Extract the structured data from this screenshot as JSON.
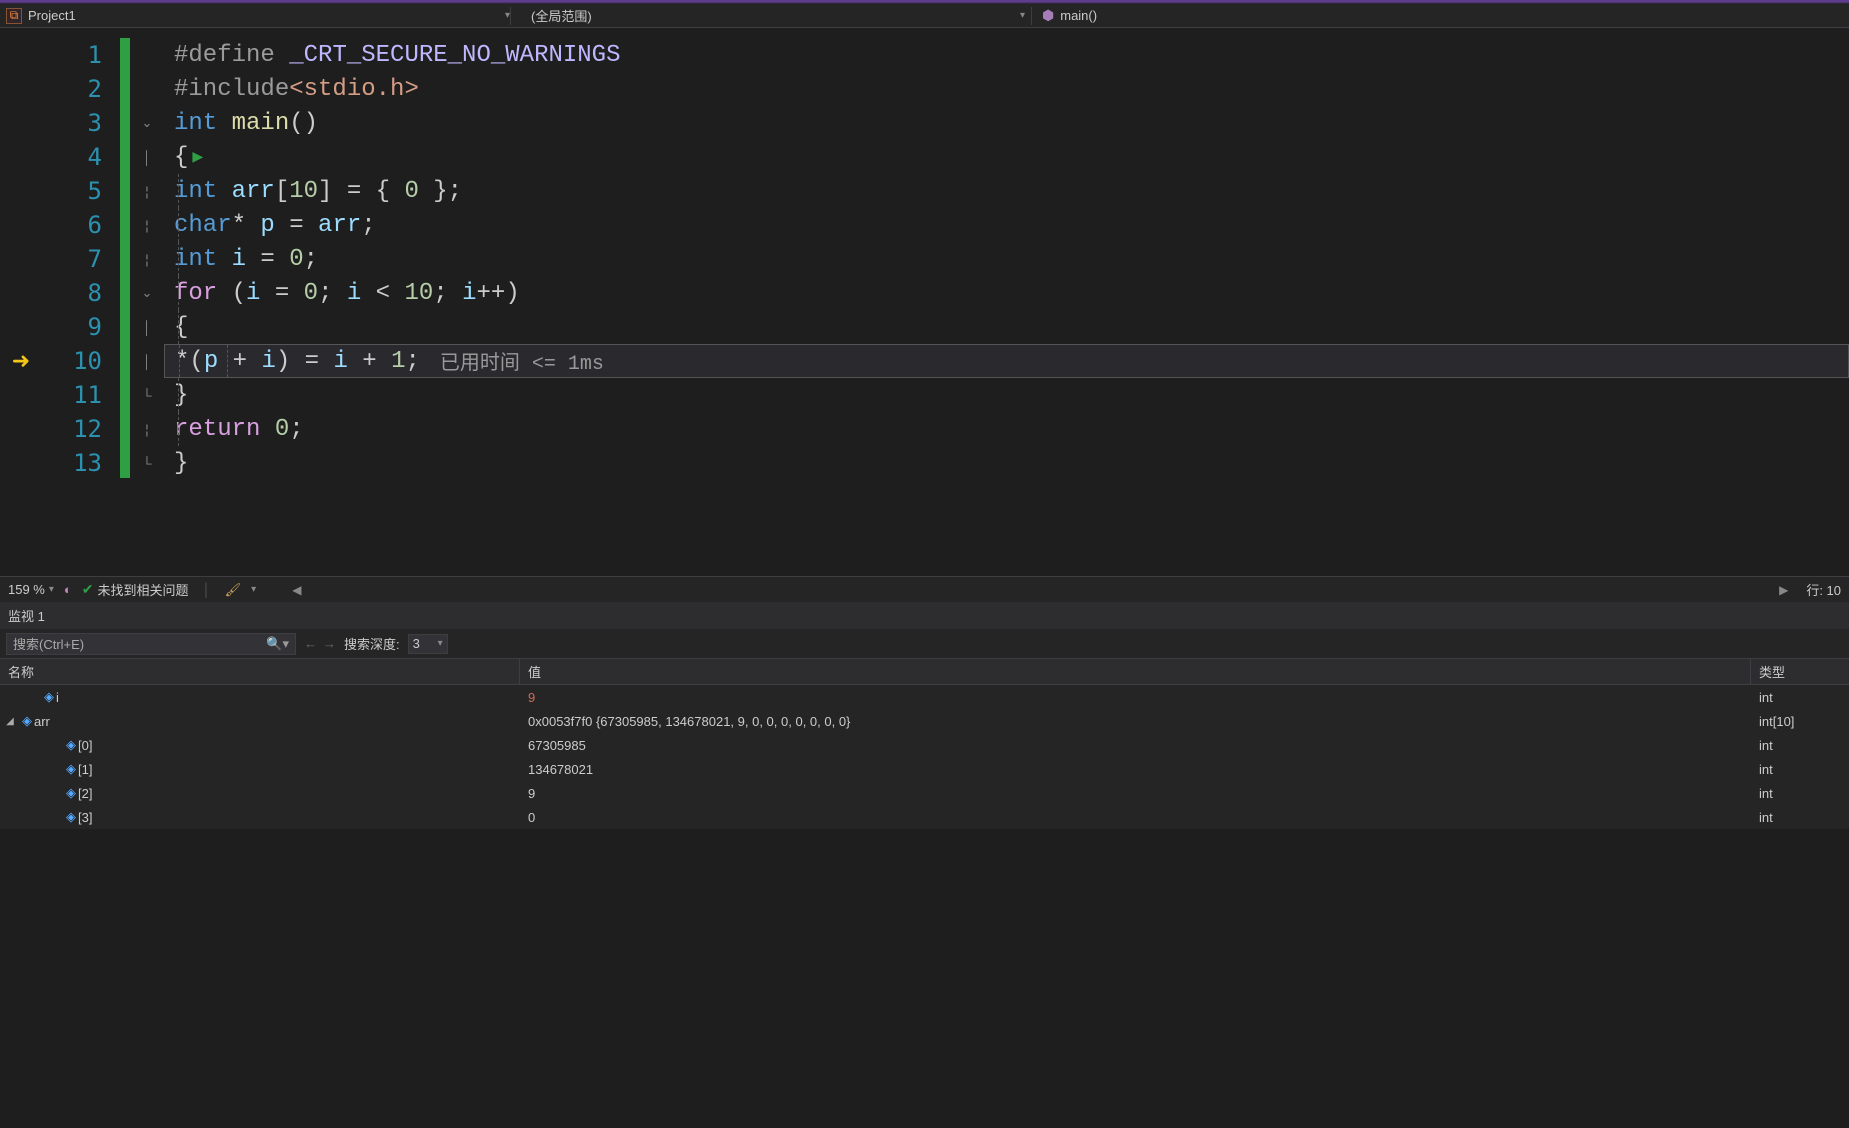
{
  "nav": {
    "project": "Project1",
    "scope": "(全局范围)",
    "function": "main()"
  },
  "code": {
    "lines": [
      "1",
      "2",
      "3",
      "4",
      "5",
      "6",
      "7",
      "8",
      "9",
      "10",
      "11",
      "12",
      "13"
    ],
    "l1_define": "#define",
    "l1_macro": " _CRT_SECURE_NO_WARNINGS",
    "l2_include": "#include",
    "l2_header": "<stdio.h>",
    "l3_int": "int",
    "l3_main": " main",
    "l3_paren": "()",
    "l4_brace": "{",
    "l5_int": "int",
    "l5_arr": " arr",
    "l5_bracket": "[",
    "l5_ten": "10",
    "l5_close": "] = { ",
    "l5_zero": "0",
    "l5_end": " };",
    "l6_char": "char",
    "l6_star": "* ",
    "l6_p": "p",
    "l6_eq": " = ",
    "l6_arr": "arr",
    "l6_semi": ";",
    "l7_int": "int",
    "l7_i": " i",
    "l7_eq": " = ",
    "l7_zero": "0",
    "l7_semi": ";",
    "l8_for": "for",
    "l8_open": " (",
    "l8_i1": "i",
    "l8_eq": " = ",
    "l8_zero": "0",
    "l8_semi1": "; ",
    "l8_i2": "i",
    "l8_lt": " < ",
    "l8_ten": "10",
    "l8_semi2": "; ",
    "l8_i3": "i",
    "l8_inc": "++)",
    "l9_brace": "{",
    "l10_star": "*(",
    "l10_p": "p",
    "l10_plus": " + ",
    "l10_i": "i",
    "l10_close": ") = ",
    "l10_i2": "i",
    "l10_plus2": " + ",
    "l10_one": "1",
    "l10_semi": ";",
    "l10_perf": "已用时间 <= 1ms",
    "l11_brace": "}",
    "l12_return": "return",
    "l12_zero": " 0",
    "l12_semi": ";",
    "l13_brace": "}"
  },
  "status": {
    "zoom": "159 %",
    "issues": "未找到相关问题",
    "line": "行: 10"
  },
  "watch": {
    "title": "监视 1",
    "search_placeholder": "搜索(Ctrl+E)",
    "depth_label": "搜索深度:",
    "depth_value": "3",
    "col_name": "名称",
    "col_value": "值",
    "col_type": "类型",
    "rows": [
      {
        "name": "i",
        "value": "9",
        "type": "int",
        "changed": true,
        "indent": 1
      },
      {
        "name": "arr",
        "value": "0x0053f7f0 {67305985, 134678021, 9, 0, 0, 0, 0, 0, 0, 0}",
        "type": "int[10]",
        "expanded": true,
        "indent": 1
      },
      {
        "name": "[0]",
        "value": "67305985",
        "type": "int",
        "indent": 2
      },
      {
        "name": "[1]",
        "value": "134678021",
        "type": "int",
        "indent": 2
      },
      {
        "name": "[2]",
        "value": "9",
        "type": "int",
        "indent": 2
      },
      {
        "name": "[3]",
        "value": "0",
        "type": "int",
        "indent": 2
      }
    ]
  }
}
